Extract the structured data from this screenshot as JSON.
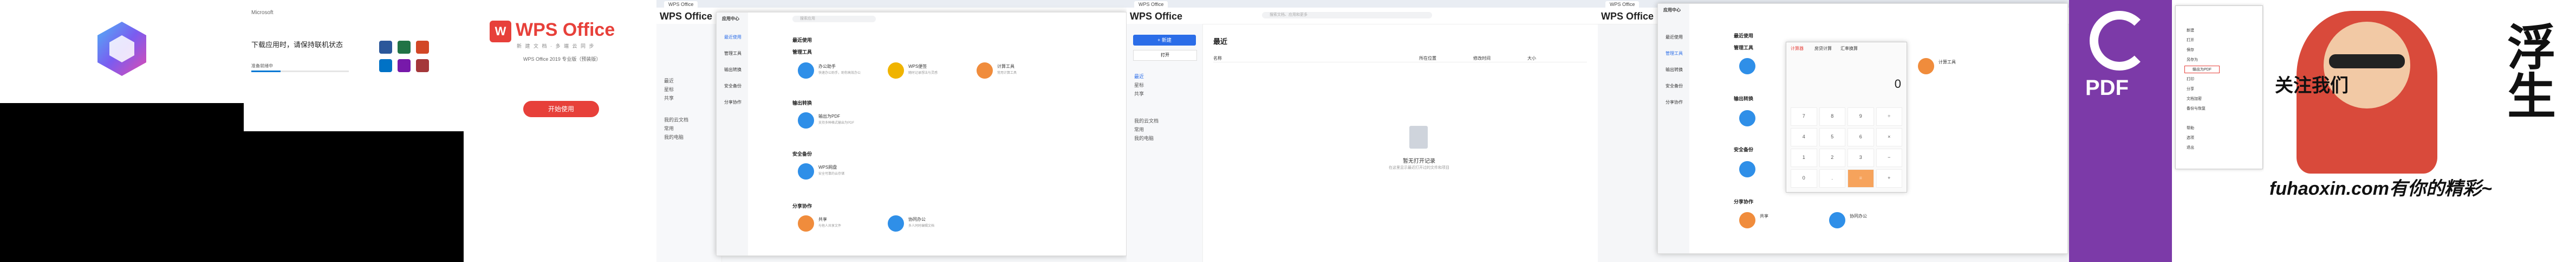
{
  "p2": {
    "brand": "Microsoft",
    "heading": "下载应用时，请保持联机状态",
    "status": "准备就绪中"
  },
  "p3": {
    "logo_text": "WPS Office",
    "slogan": "新 建 文 档 · 多 端 云 同 步",
    "version": "WPS Office 2019 专业版（预装版）",
    "start_button": "开始使用"
  },
  "p4": {
    "tab": "WPS Office",
    "logo": "WPS Office",
    "dialog_title": "应用中心",
    "search_placeholder": "搜索应用",
    "section_recent": "最近使用",
    "section_manage": "管理工具",
    "section_output": "输出转换",
    "section_security": "安全备份",
    "section_share": "分享协作",
    "side_items": [
      "最近使用",
      "管理工具",
      "输出转换",
      "安全备份",
      "分享协作"
    ],
    "apps": {
      "a1_title": "办公助手",
      "a1_desc": "快速办公助手，助你高效办公",
      "a2_title": "WPS便签",
      "a2_desc": "随时记录想法与灵感",
      "a3_title": "计算工具",
      "a3_desc": "常用计算工具",
      "a4_title": "输出为PDF",
      "a4_desc": "支持多种格式输出为PDF",
      "a5_title": "WPS网盘",
      "a5_desc": "安全可靠的云存储",
      "a6_title": "共享",
      "a6_desc": "与他人共享文件",
      "a7_title": "协同办公",
      "a7_desc": "多人同时编辑文档"
    },
    "sidebar_items": [
      "最近",
      "星标",
      "共享",
      "我的云文档",
      "常用",
      "我的电脑"
    ]
  },
  "p5": {
    "tab": "WPS Office",
    "logo": "WPS Office",
    "new_button": "+ 新建",
    "open_label": "打开",
    "recent_label": "最近",
    "search_placeholder": "搜索文档、应用和更多",
    "empty_title": "暂无打开记录",
    "empty_desc": "在这里显示最近打开过的文件和项目",
    "columns": [
      "名称",
      "所在位置",
      "修改时间",
      "大小"
    ],
    "sidebar_items": [
      "最近",
      "星标",
      "共享",
      "我的云文档",
      "常用",
      "我的电脑"
    ]
  },
  "p6": {
    "tab": "WPS Office",
    "logo": "WPS Office",
    "dialog_title": "应用中心",
    "calc_display": "0",
    "calc_tabs": [
      "计算器",
      "房贷计算",
      "汇率换算"
    ],
    "keys": [
      "7",
      "8",
      "9",
      "÷",
      "4",
      "5",
      "6",
      "×",
      "1",
      "2",
      "3",
      "−",
      "0",
      ".",
      "=",
      "+"
    ],
    "apps": {
      "a1_title": "计算工具",
      "a2_title": "共享",
      "a3_title": "协同办公"
    },
    "sections": [
      "最近使用",
      "管理工具",
      "输出转换",
      "安全备份",
      "分享协作"
    ],
    "side_items": [
      "最近使用",
      "管理工具",
      "输出转换",
      "安全备份",
      "分享协作"
    ]
  },
  "p7": {
    "pdf_label": "PDF",
    "menu_items": [
      "新建",
      "打开",
      "保存",
      "另存为",
      "输出为PDF",
      "打印",
      "分享",
      "文档加密",
      "备份与恢复",
      "帮助",
      "选项",
      "退出"
    ]
  },
  "p8": {
    "caption_top": "关注我们",
    "caption_bottom": "fuhaoxin.com有你的精彩~",
    "vertical_text": "浮生"
  }
}
